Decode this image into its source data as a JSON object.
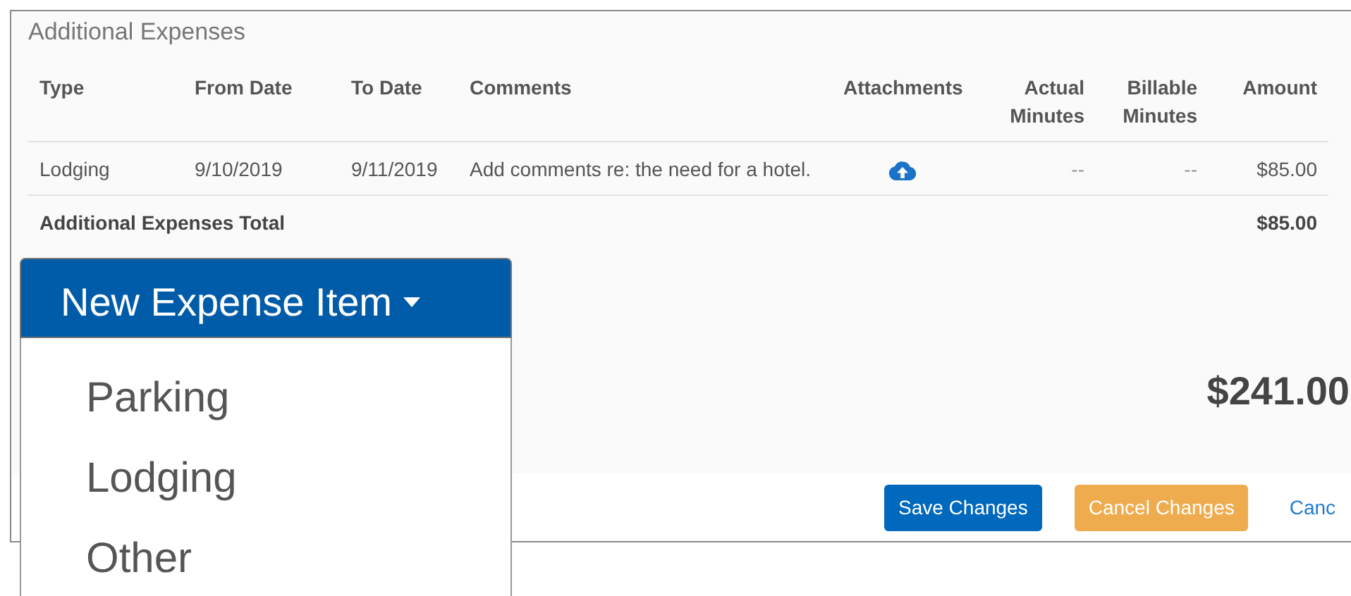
{
  "section": {
    "title": "Additional Expenses"
  },
  "table": {
    "columns": [
      "Type",
      "From Date",
      "To Date",
      "Comments",
      "Attachments",
      "Actual Minutes",
      "Billable Minutes",
      "Amount"
    ],
    "rows": [
      {
        "type": "Lodging",
        "from": "9/10/2019",
        "to": "9/11/2019",
        "comments": "Add comments re: the need for a hotel.",
        "actual": "--",
        "billable": "--",
        "amount": "$85.00"
      }
    ],
    "total": {
      "label": "Additional Expenses Total",
      "amount": "$85.00"
    }
  },
  "grand_total": "$241.00",
  "dropdown": {
    "label": "New Expense Item",
    "expanded": true,
    "items": [
      "Parking",
      "Lodging",
      "Other"
    ]
  },
  "buttons": [
    {
      "label": "Save Changes",
      "kind": "primary"
    },
    {
      "label": "Cancel Changes",
      "kind": "warning"
    },
    {
      "label": "Canc",
      "kind": "link"
    }
  ]
}
